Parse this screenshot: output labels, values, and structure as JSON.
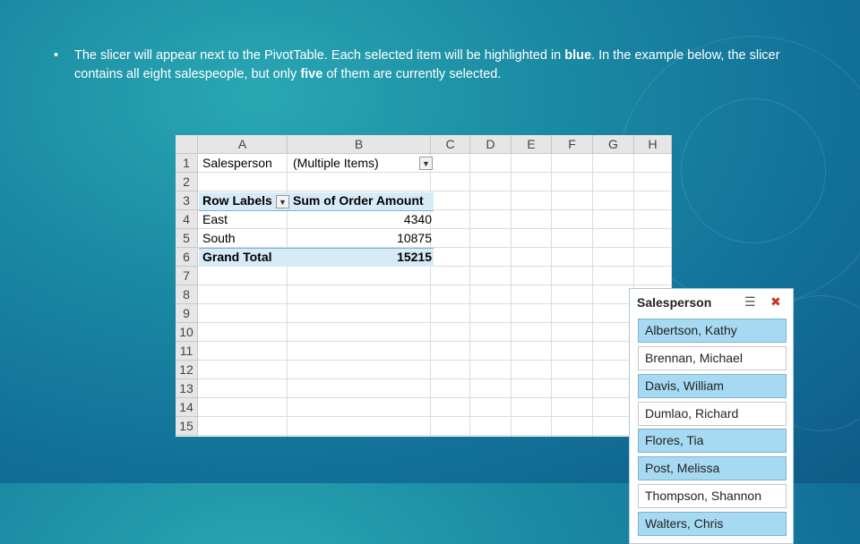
{
  "slide": {
    "bullet_symbol": "•",
    "text_part1": "The slicer will appear next to the PivotTable. Each selected item will be highlighted in ",
    "text_bold1": "blue",
    "text_part2": ". In the example below, the slicer contains all eight salespeople, but only ",
    "text_bold2": "five",
    "text_part3": " of them are currently selected."
  },
  "spreadsheet": {
    "columns": [
      "A",
      "B",
      "C",
      "D",
      "E",
      "F",
      "G",
      "H"
    ],
    "rows": [
      "1",
      "2",
      "3",
      "4",
      "5",
      "6",
      "7",
      "8",
      "9",
      "10",
      "11",
      "12",
      "13",
      "14",
      "15"
    ],
    "filter": {
      "label": "Salesperson",
      "value": "(Multiple Items)"
    },
    "pivot": {
      "row_labels_header": "Row Labels",
      "sum_header": "Sum of Order Amount",
      "rows": [
        {
          "label": "East",
          "value": "4340"
        },
        {
          "label": "South",
          "value": "10875"
        }
      ],
      "grand_total_label": "Grand Total",
      "grand_total_value": "15215"
    }
  },
  "slicer": {
    "title": "Salesperson",
    "multiselect_icon": "multi-select-icon",
    "clear_filter_icon": "clear-filter-icon",
    "items": [
      {
        "label": "Albertson, Kathy",
        "selected": true
      },
      {
        "label": "Brennan, Michael",
        "selected": false
      },
      {
        "label": "Davis, William",
        "selected": true
      },
      {
        "label": "Dumlao, Richard",
        "selected": false
      },
      {
        "label": "Flores, Tia",
        "selected": true
      },
      {
        "label": "Post, Melissa",
        "selected": true
      },
      {
        "label": "Thompson, Shannon",
        "selected": false
      },
      {
        "label": "Walters, Chris",
        "selected": true
      }
    ]
  },
  "colors": {
    "selected": "#a6daf2",
    "background": "#1a8aa3"
  }
}
